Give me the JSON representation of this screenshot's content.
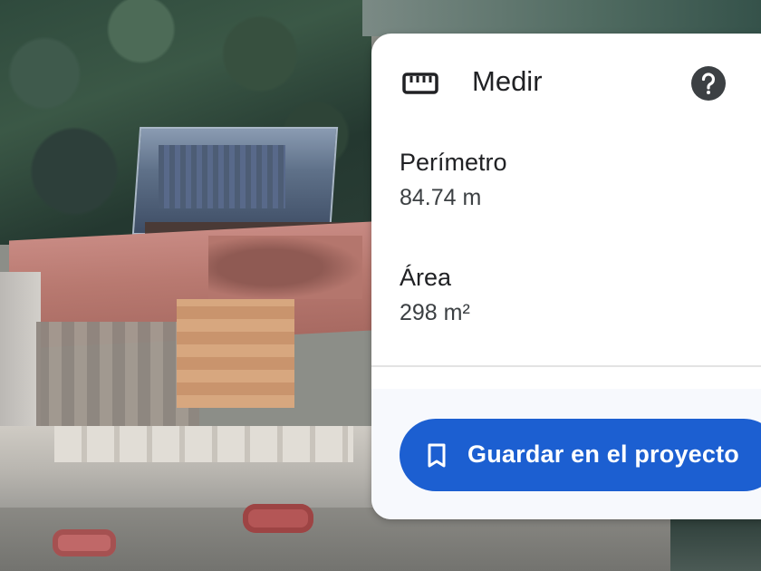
{
  "panel": {
    "title": "Medir",
    "title_icon": "ruler-icon",
    "help_icon": "help-icon"
  },
  "metrics": {
    "perimeter": {
      "label": "Perímetro",
      "value": "84.74 m"
    },
    "area": {
      "label": "Área",
      "value": "298 m²"
    }
  },
  "actions": {
    "save_label": "Guardar en el proyecto",
    "save_icon": "bookmark-icon"
  },
  "colors": {
    "accent": "#1c5fd1",
    "panel_bg": "#ffffff",
    "footer_bg": "#f7f9fd",
    "help_icon": "#3c4043"
  }
}
